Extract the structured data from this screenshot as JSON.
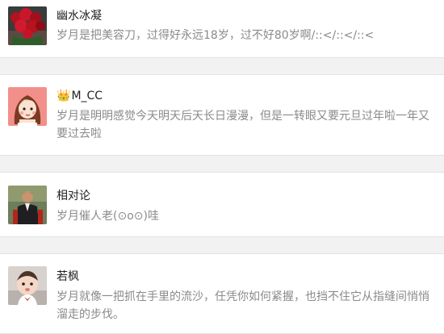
{
  "comments": [
    {
      "user": "幽水冰凝",
      "text": "岁月是把美容刀，过得好永远18岁，过不好80岁啊/::</::</::<",
      "avatar": "roses-photo"
    },
    {
      "user": "M_CC",
      "user_badge": "crown-emoji",
      "text": "岁月是明明感觉今天明天后天长日漫漫，但是一转眼又要元旦过年啦一年又要过去啦",
      "avatar": "cartoon-girl"
    },
    {
      "user": "相对论",
      "text": "岁月催人老(⊙o⊙)哇",
      "avatar": "man-photo"
    },
    {
      "user": "若枫",
      "text": "岁月就像一把抓在手里的流沙，任凭你如何紧握，也挡不住它从指缝间悄悄溜走的步伐。",
      "avatar": "baby-photo"
    }
  ],
  "colors": {
    "background": "#f2f2f2",
    "card": "#ffffff",
    "name": "#222222",
    "text": "#8a8a8a"
  }
}
